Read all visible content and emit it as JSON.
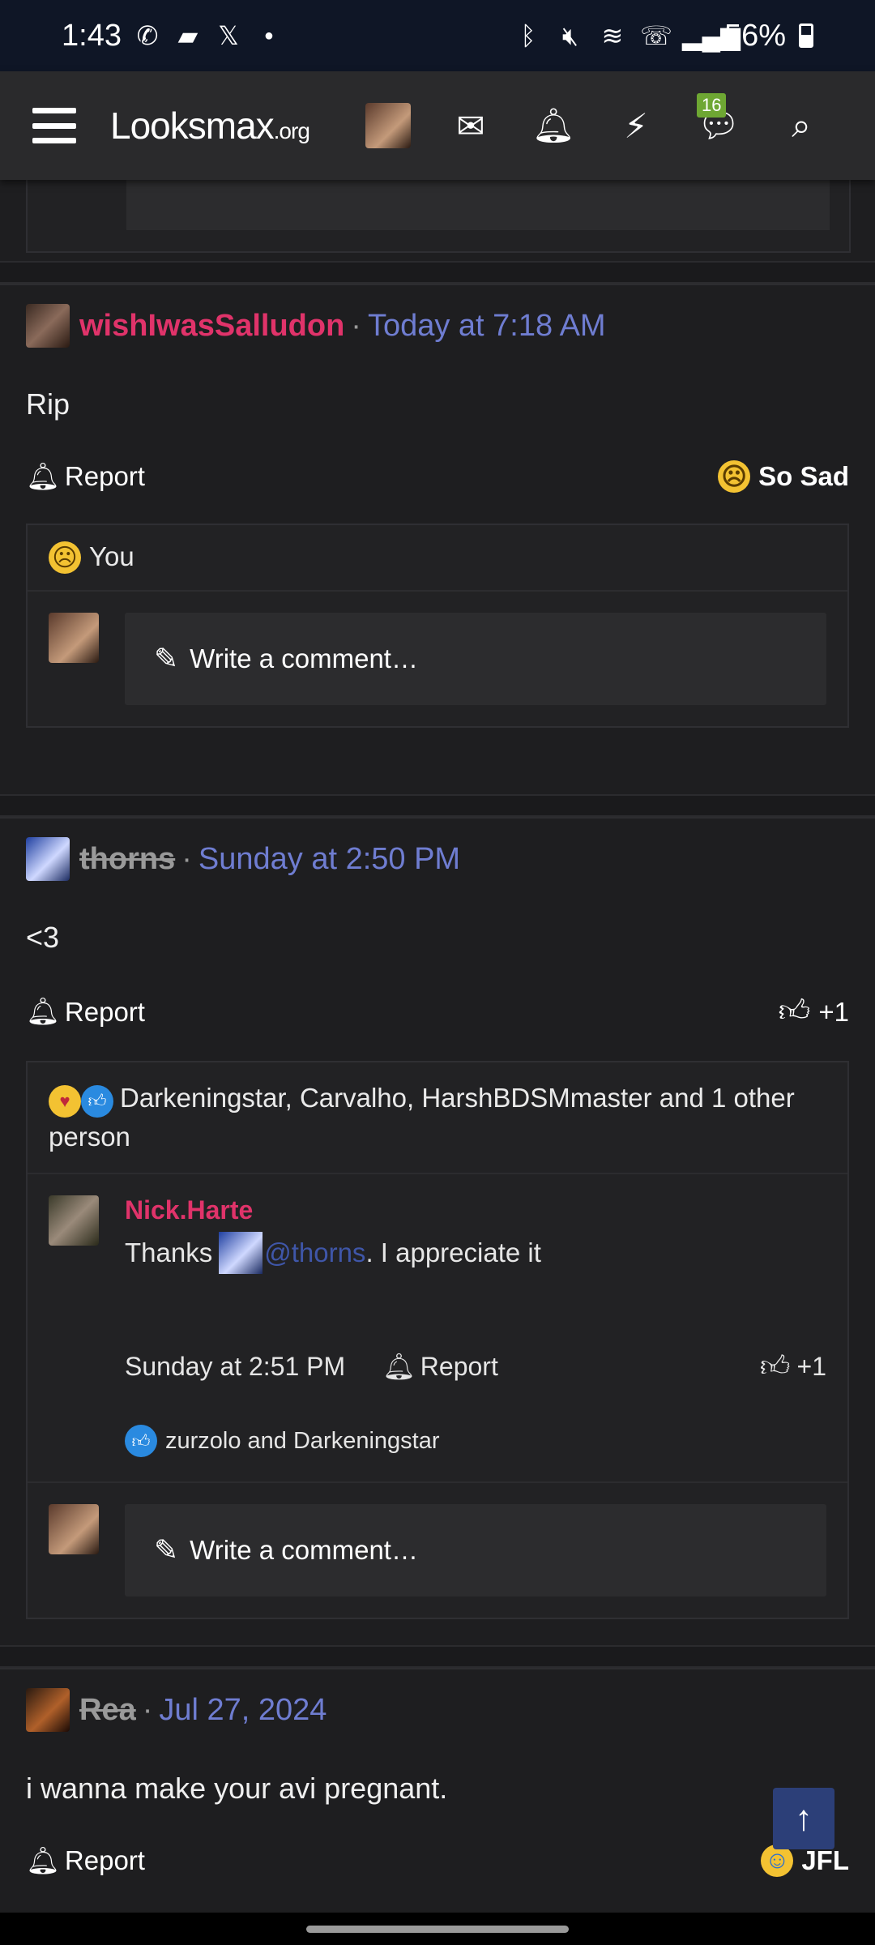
{
  "status_bar": {
    "time": "1:43",
    "battery": "56%"
  },
  "nav": {
    "logo": "Looksmax",
    "logo_suffix": ".org",
    "chat_badge": "16"
  },
  "posts": [
    {
      "username": "wishIwasSalludon",
      "time": "Today at 7:18 AM",
      "text": "Rip",
      "report_label": "Report",
      "reaction_label": "So Sad",
      "reactors": "You",
      "comment_placeholder": "Write a comment…"
    },
    {
      "username": "thorns",
      "time": "Sunday at 2:50 PM",
      "text": "<3",
      "report_label": "Report",
      "reaction_label": "+1",
      "reactors": "Darkeningstar, Carvalho, HarshBDSMmaster and 1 other person",
      "reply": {
        "username": "Nick.Harte",
        "text_before": "Thanks",
        "mention": "@thorns",
        "text_after": ". I appreciate it",
        "time": "Sunday at 2:51 PM",
        "report_label": "Report",
        "reaction_label": "+1",
        "reactors": "zurzolo and Darkeningstar"
      },
      "comment_placeholder": "Write a comment…"
    },
    {
      "username": "Rea",
      "time": "Jul 27, 2024",
      "text": "i wanna make your avi pregnant.",
      "report_label": "Report",
      "reaction_label": "JFL"
    }
  ]
}
